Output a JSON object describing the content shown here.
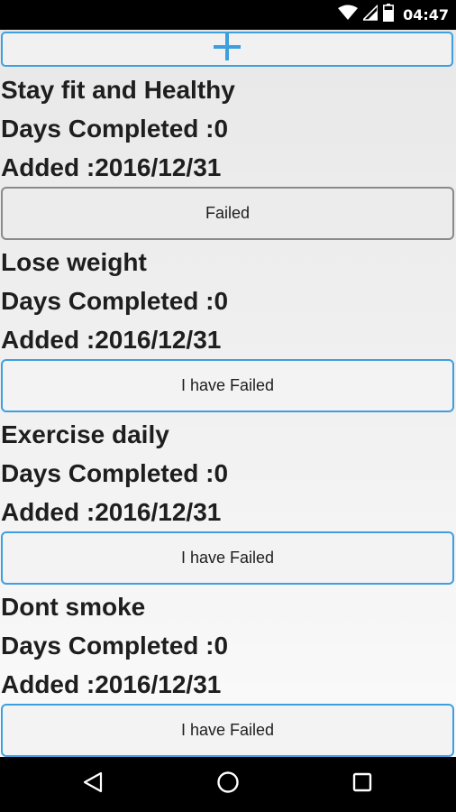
{
  "status_bar": {
    "time": "04:47",
    "icons": [
      "wifi-icon",
      "cell-signal-icon",
      "battery-icon"
    ]
  },
  "add_button": {
    "icon": "plus-icon",
    "color": "#3e9fe0"
  },
  "goals": [
    {
      "title": "Stay fit and Healthy",
      "days_completed": "Days Completed :0",
      "added": "Added :2016/12/31",
      "button_label": "Failed",
      "button_style": "grey"
    },
    {
      "title": "Lose weight",
      "days_completed": "Days Completed :0",
      "added": "Added :2016/12/31",
      "button_label": "I have Failed",
      "button_style": "blue"
    },
    {
      "title": "Exercise daily",
      "days_completed": "Days Completed :0",
      "added": "Added :2016/12/31",
      "button_label": "I have Failed",
      "button_style": "blue"
    },
    {
      "title": "Dont smoke",
      "days_completed": "Days Completed :0",
      "added": "Added :2016/12/31",
      "button_label": "I have Failed",
      "button_style": "blue"
    }
  ],
  "nav_bar": {
    "icons": [
      "back-icon",
      "home-icon",
      "recents-icon"
    ]
  },
  "colors": {
    "accent": "#3e9fe0",
    "failed_border": "#8a8a8a",
    "text": "#1e1e1e"
  }
}
